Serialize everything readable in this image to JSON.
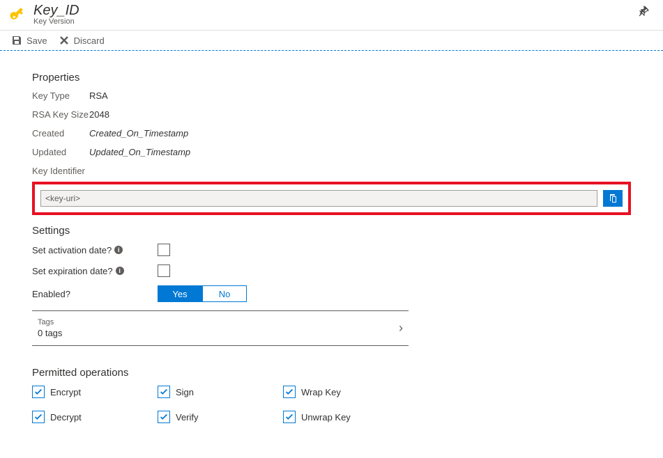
{
  "header": {
    "title": "Key_ID",
    "subtitle": "Key Version"
  },
  "toolbar": {
    "save": "Save",
    "discard": "Discard"
  },
  "properties": {
    "section_title": "Properties",
    "key_type_label": "Key Type",
    "key_type_value": "RSA",
    "rsa_size_label": "RSA Key Size",
    "rsa_size_value": "2048",
    "created_label": "Created",
    "created_value": "Created_On_Timestamp",
    "updated_label": "Updated",
    "updated_value": "Updated_On_Timestamp",
    "key_identifier_label": "Key Identifier",
    "key_uri_value": "<key-uri>"
  },
  "settings": {
    "section_title": "Settings",
    "activation_label": "Set activation date?",
    "expiration_label": "Set expiration date?",
    "enabled_label": "Enabled?",
    "yes": "Yes",
    "no": "No",
    "tags_label": "Tags",
    "tags_count": "0 tags"
  },
  "permitted": {
    "section_title": "Permitted operations",
    "ops": [
      "Encrypt",
      "Sign",
      "Wrap Key",
      "Decrypt",
      "Verify",
      "Unwrap Key"
    ]
  }
}
